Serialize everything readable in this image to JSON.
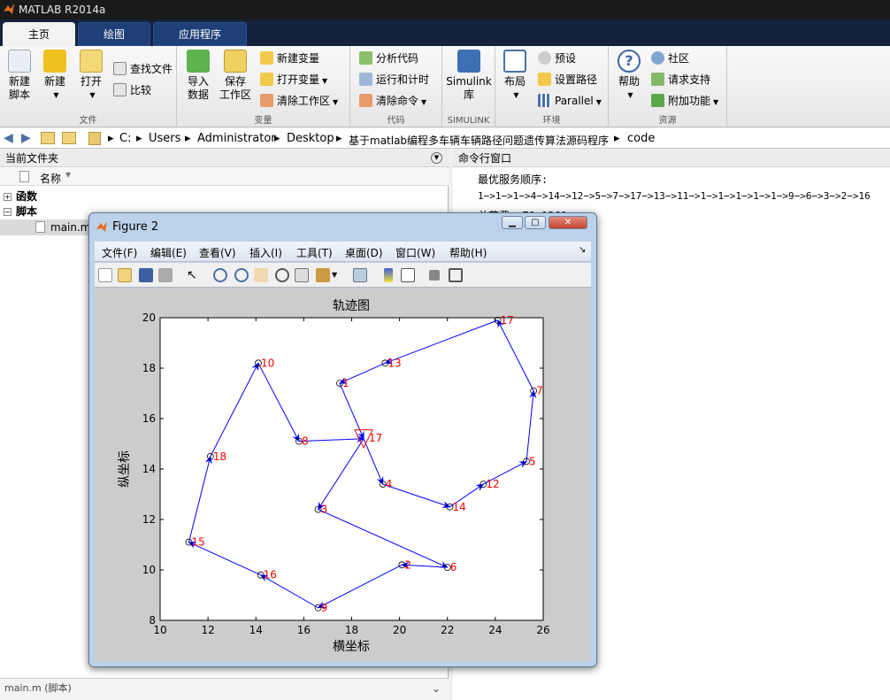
{
  "app": {
    "title": "MATLAB R2014a"
  },
  "tabs": [
    {
      "label": "主页"
    },
    {
      "label": "绘图"
    },
    {
      "label": "应用程序"
    }
  ],
  "ribbon": {
    "file": {
      "label": "文件",
      "new_script": "新建\n脚本",
      "new": "新建",
      "open": "打开",
      "find_files": "查找文件",
      "compare": "比较"
    },
    "variable": {
      "label": "变量",
      "import": "导入\n数据",
      "save_ws": "保存\n工作区",
      "new_var": "新建变量",
      "open_var": "打开变量",
      "clear_ws": "清除工作区"
    },
    "code": {
      "label": "代码",
      "analyze": "分析代码",
      "run_time": "运行和计时",
      "clear_cmd": "清除命令"
    },
    "simulink": {
      "label": "SIMULINK",
      "btn": "Simulink\n库"
    },
    "env": {
      "label": "环境",
      "layout": "布局",
      "prefs": "预设",
      "set_path": "设置路径",
      "parallel": "Parallel"
    },
    "resources": {
      "label": "资源",
      "help": "帮助",
      "community": "社区",
      "support": "请求支持",
      "addons": "附加功能"
    }
  },
  "address": {
    "crumbs": [
      "C:",
      "Users",
      "Administrator",
      "Desktop",
      "基于matlab编程多车辆车辆路径问题遗传算法源码程序",
      "code"
    ]
  },
  "current_folder": {
    "title": "当前文件夹",
    "column_name": "名称",
    "groups": [
      {
        "label": "函数",
        "sign": "+"
      },
      {
        "label": "脚本",
        "sign": "−"
      }
    ],
    "file": "main.m",
    "detail": "main.m (脚本)"
  },
  "command_window": {
    "title": "命令行窗口",
    "line1": "最优服务顺序:",
    "line2": "1−>1−>1−>4−>14−>12−>5−>7−>17−>13−>11−>1−>1−>1−>1−>1−>9−>6−>3−>2−>16",
    "line3": "总花费: 79.1261"
  },
  "figure": {
    "title": "Figure 2",
    "menus": [
      "文件(F)",
      "编辑(E)",
      "查看(V)",
      "插入(I)",
      "工具(T)",
      "桌面(D)",
      "窗口(W)",
      "帮助(H)"
    ]
  },
  "chart_data": {
    "type": "scatter",
    "title": "轨迹图",
    "xlabel": "横坐标",
    "ylabel": "纵坐标",
    "xlim": [
      10,
      26
    ],
    "ylim": [
      8,
      20
    ],
    "xticks": [
      10,
      12,
      14,
      16,
      18,
      20,
      22,
      24,
      26
    ],
    "yticks": [
      8,
      10,
      12,
      14,
      16,
      18,
      20
    ],
    "grid": false,
    "depot": {
      "label": "17",
      "x": 18.5,
      "y": 15.2
    },
    "points": [
      {
        "label": "1",
        "x": 17.5,
        "y": 17.4
      },
      {
        "label": "2",
        "x": 20.1,
        "y": 10.2
      },
      {
        "label": "3",
        "x": 16.6,
        "y": 12.4
      },
      {
        "label": "4",
        "x": 19.3,
        "y": 13.4
      },
      {
        "label": "5",
        "x": 25.3,
        "y": 14.3
      },
      {
        "label": "6",
        "x": 22.0,
        "y": 10.1
      },
      {
        "label": "7",
        "x": 25.6,
        "y": 17.1
      },
      {
        "label": "8",
        "x": 15.8,
        "y": 15.1
      },
      {
        "label": "9",
        "x": 16.6,
        "y": 8.5
      },
      {
        "label": "10",
        "x": 14.1,
        "y": 18.2
      },
      {
        "label": "12",
        "x": 23.5,
        "y": 13.4
      },
      {
        "label": "13",
        "x": 19.4,
        "y": 18.2
      },
      {
        "label": "14",
        "x": 22.1,
        "y": 12.5
      },
      {
        "label": "15",
        "x": 11.2,
        "y": 11.1
      },
      {
        "label": "16",
        "x": 14.2,
        "y": 9.8
      },
      {
        "label": "17",
        "x": 24.1,
        "y": 19.9
      },
      {
        "label": "18",
        "x": 12.1,
        "y": 14.5
      }
    ],
    "routes": [
      [
        [
          18.5,
          15.2
        ],
        [
          19.3,
          13.4
        ],
        [
          22.1,
          12.5
        ],
        [
          23.5,
          13.4
        ],
        [
          25.3,
          14.3
        ],
        [
          25.6,
          17.1
        ],
        [
          24.1,
          19.9
        ],
        [
          19.4,
          18.2
        ],
        [
          17.5,
          17.4
        ],
        [
          18.5,
          15.2
        ]
      ],
      [
        [
          18.5,
          15.2
        ],
        [
          16.6,
          12.4
        ],
        [
          22.0,
          10.1
        ],
        [
          20.1,
          10.2
        ],
        [
          16.6,
          8.5
        ],
        [
          14.2,
          9.8
        ],
        [
          11.2,
          11.1
        ],
        [
          12.1,
          14.5
        ],
        [
          14.1,
          18.2
        ],
        [
          15.8,
          15.1
        ],
        [
          18.5,
          15.2
        ]
      ]
    ],
    "colors": {
      "route": "#0000ff",
      "label": "#ff0000",
      "marker": "#000000",
      "depot": "#ff0000"
    }
  }
}
